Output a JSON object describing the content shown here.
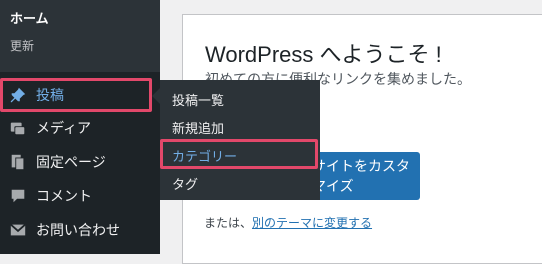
{
  "sidebar": {
    "home_label": "ホーム",
    "update_label": "更新",
    "items": [
      {
        "label": "投稿",
        "icon": "pin-icon"
      },
      {
        "label": "メディア",
        "icon": "media-icon"
      },
      {
        "label": "固定ページ",
        "icon": "page-icon"
      },
      {
        "label": "コメント",
        "icon": "comment-icon"
      },
      {
        "label": "お問い合わせ",
        "icon": "mail-icon"
      }
    ]
  },
  "flyout": {
    "items": [
      {
        "label": "投稿一覧"
      },
      {
        "label": "新規追加"
      },
      {
        "label": "カテゴリー"
      },
      {
        "label": "タグ"
      }
    ]
  },
  "welcome": {
    "title": "WordPress へようこそ !",
    "subtitle": "初めての方に便利なリンクを集めました。",
    "customize_button": "サイトをカスタマイズ",
    "or_text": "または、",
    "change_theme_link": "別のテーマに変更する"
  },
  "colors": {
    "sidebar_bg": "#1d2327",
    "accent": "#72aee6",
    "highlight": "#e2486a",
    "button": "#2271b1"
  }
}
